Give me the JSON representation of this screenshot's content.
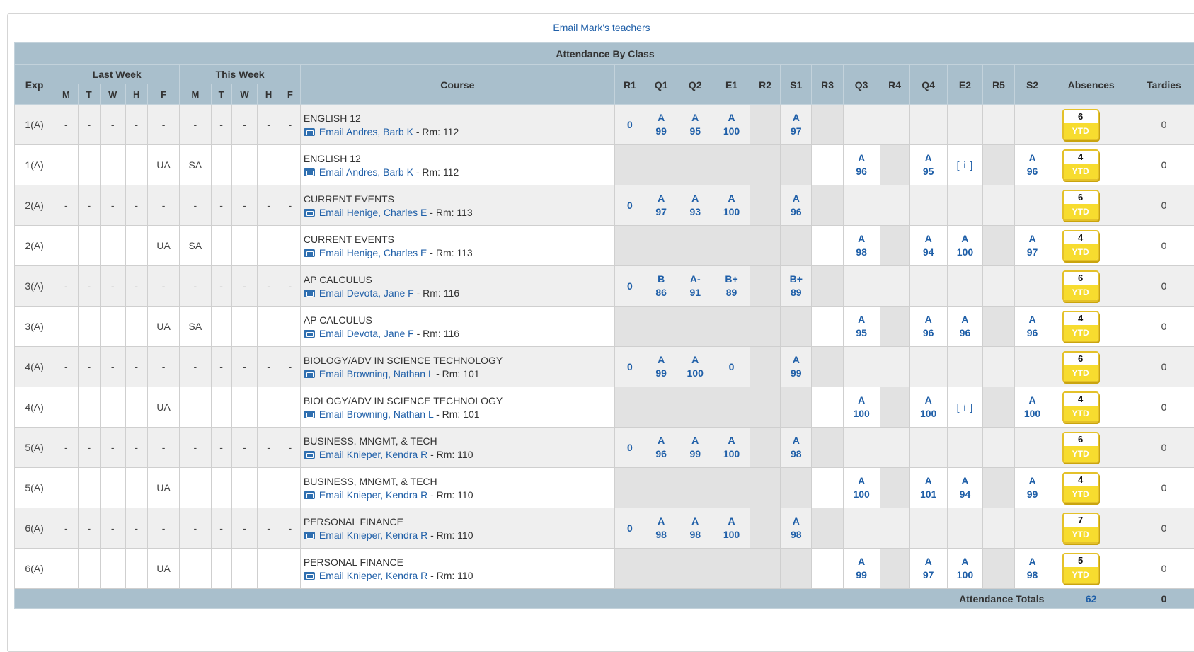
{
  "email_link": "Email Mark's teachers",
  "table_title": "Attendance By Class",
  "headers": {
    "exp": "Exp",
    "last_week": "Last Week",
    "this_week": "This Week",
    "days": [
      "M",
      "T",
      "W",
      "H",
      "F"
    ],
    "course": "Course",
    "terms": [
      "R1",
      "Q1",
      "Q2",
      "E1",
      "R2",
      "S1",
      "R3",
      "Q3",
      "R4",
      "Q4",
      "E2",
      "R5",
      "S2"
    ],
    "absences": "Absences",
    "tardies": "Tardies"
  },
  "ytd_label": "YTD",
  "rows": [
    {
      "exp": "1(A)",
      "days": [
        "-",
        "-",
        "-",
        "-",
        "-",
        "-",
        "-",
        "-",
        "-",
        "-"
      ],
      "course": "ENGLISH 12",
      "email": "Email Andres, Barb K",
      "room": " - Rm: 112",
      "terms": [
        {
          "v": "0"
        },
        {
          "l": "A",
          "n": "99"
        },
        {
          "l": "A",
          "n": "95"
        },
        {
          "l": "A",
          "n": "100"
        },
        {
          "h": 1
        },
        {
          "l": "A",
          "n": "97"
        },
        {
          "h": 1
        },
        {},
        {},
        {},
        {},
        {},
        {}
      ],
      "absences": "6",
      "tardies": "0"
    },
    {
      "exp": "1(A)",
      "days": [
        "",
        "",
        "",
        "",
        "UA",
        "SA",
        "",
        "",
        "",
        ""
      ],
      "course": "ENGLISH 12",
      "email": "Email Andres, Barb K",
      "room": " - Rm: 112",
      "terms": [
        {
          "h": 1
        },
        {
          "h": 1
        },
        {
          "h": 1
        },
        {
          "h": 1
        },
        {
          "h": 1
        },
        {
          "h": 1
        },
        {},
        {
          "l": "A",
          "n": "96"
        },
        {
          "h": 1
        },
        {
          "l": "A",
          "n": "95"
        },
        {
          "i": "[ i ]"
        },
        {
          "h": 1
        },
        {
          "l": "A",
          "n": "96"
        }
      ],
      "absences": "4",
      "tardies": "0"
    },
    {
      "exp": "2(A)",
      "days": [
        "-",
        "-",
        "-",
        "-",
        "-",
        "-",
        "-",
        "-",
        "-",
        "-"
      ],
      "course": "CURRENT EVENTS",
      "email": "Email Henige, Charles E",
      "room": " - Rm: 113",
      "terms": [
        {
          "v": "0"
        },
        {
          "l": "A",
          "n": "97"
        },
        {
          "l": "A",
          "n": "93"
        },
        {
          "l": "A",
          "n": "100"
        },
        {
          "h": 1
        },
        {
          "l": "A",
          "n": "96"
        },
        {
          "h": 1
        },
        {},
        {},
        {},
        {},
        {},
        {}
      ],
      "absences": "6",
      "tardies": "0"
    },
    {
      "exp": "2(A)",
      "days": [
        "",
        "",
        "",
        "",
        "UA",
        "SA",
        "",
        "",
        "",
        ""
      ],
      "course": "CURRENT EVENTS",
      "email": "Email Henige, Charles E",
      "room": " - Rm: 113",
      "terms": [
        {
          "h": 1
        },
        {
          "h": 1
        },
        {
          "h": 1
        },
        {
          "h": 1
        },
        {
          "h": 1
        },
        {
          "h": 1
        },
        {},
        {
          "l": "A",
          "n": "98"
        },
        {
          "h": 1
        },
        {
          "l": "A",
          "n": "94"
        },
        {
          "l": "A",
          "n": "100"
        },
        {
          "h": 1
        },
        {
          "l": "A",
          "n": "97"
        }
      ],
      "absences": "4",
      "tardies": "0"
    },
    {
      "exp": "3(A)",
      "days": [
        "-",
        "-",
        "-",
        "-",
        "-",
        "-",
        "-",
        "-",
        "-",
        "-"
      ],
      "course": "AP CALCULUS",
      "email": "Email Devota, Jane F",
      "room": " - Rm: 116",
      "terms": [
        {
          "v": "0"
        },
        {
          "l": "B",
          "n": "86"
        },
        {
          "l": "A-",
          "n": "91"
        },
        {
          "l": "B+",
          "n": "89"
        },
        {
          "h": 1
        },
        {
          "l": "B+",
          "n": "89"
        },
        {
          "h": 1
        },
        {},
        {},
        {},
        {},
        {},
        {}
      ],
      "absences": "6",
      "tardies": "0"
    },
    {
      "exp": "3(A)",
      "days": [
        "",
        "",
        "",
        "",
        "UA",
        "SA",
        "",
        "",
        "",
        ""
      ],
      "course": "AP CALCULUS",
      "email": "Email Devota, Jane F",
      "room": " - Rm: 116",
      "terms": [
        {
          "h": 1
        },
        {
          "h": 1
        },
        {
          "h": 1
        },
        {
          "h": 1
        },
        {
          "h": 1
        },
        {
          "h": 1
        },
        {},
        {
          "l": "A",
          "n": "95"
        },
        {
          "h": 1
        },
        {
          "l": "A",
          "n": "96"
        },
        {
          "l": "A",
          "n": "96"
        },
        {
          "h": 1
        },
        {
          "l": "A",
          "n": "96"
        }
      ],
      "absences": "4",
      "tardies": "0"
    },
    {
      "exp": "4(A)",
      "days": [
        "-",
        "-",
        "-",
        "-",
        "-",
        "-",
        "-",
        "-",
        "-",
        "-"
      ],
      "course": "BIOLOGY/ADV IN SCIENCE TECHNOLOGY",
      "email": "Email Browning, Nathan L",
      "room": " - Rm: 101",
      "terms": [
        {
          "v": "0"
        },
        {
          "l": "A",
          "n": "99"
        },
        {
          "l": "A",
          "n": "100"
        },
        {
          "v": "0"
        },
        {
          "h": 1
        },
        {
          "l": "A",
          "n": "99"
        },
        {
          "h": 1
        },
        {},
        {},
        {},
        {},
        {},
        {}
      ],
      "absences": "6",
      "tardies": "0"
    },
    {
      "exp": "4(A)",
      "days": [
        "",
        "",
        "",
        "",
        "UA",
        "",
        "",
        "",
        "",
        ""
      ],
      "course": "BIOLOGY/ADV IN SCIENCE TECHNOLOGY",
      "email": "Email Browning, Nathan L",
      "room": " - Rm: 101",
      "terms": [
        {
          "h": 1
        },
        {
          "h": 1
        },
        {
          "h": 1
        },
        {
          "h": 1
        },
        {
          "h": 1
        },
        {
          "h": 1
        },
        {},
        {
          "l": "A",
          "n": "100"
        },
        {
          "h": 1
        },
        {
          "l": "A",
          "n": "100"
        },
        {
          "i": "[ i ]"
        },
        {
          "h": 1
        },
        {
          "l": "A",
          "n": "100"
        }
      ],
      "absences": "4",
      "tardies": "0"
    },
    {
      "exp": "5(A)",
      "days": [
        "-",
        "-",
        "-",
        "-",
        "-",
        "-",
        "-",
        "-",
        "-",
        "-"
      ],
      "course": "BUSINESS, MNGMT, & TECH",
      "email": "Email Knieper, Kendra R",
      "room": " - Rm: 110",
      "terms": [
        {
          "v": "0"
        },
        {
          "l": "A",
          "n": "96"
        },
        {
          "l": "A",
          "n": "99"
        },
        {
          "l": "A",
          "n": "100"
        },
        {
          "h": 1
        },
        {
          "l": "A",
          "n": "98"
        },
        {
          "h": 1
        },
        {},
        {},
        {},
        {},
        {},
        {}
      ],
      "absences": "6",
      "tardies": "0"
    },
    {
      "exp": "5(A)",
      "days": [
        "",
        "",
        "",
        "",
        "UA",
        "",
        "",
        "",
        "",
        ""
      ],
      "course": "BUSINESS, MNGMT, & TECH",
      "email": "Email Knieper, Kendra R",
      "room": " - Rm: 110",
      "terms": [
        {
          "h": 1
        },
        {
          "h": 1
        },
        {
          "h": 1
        },
        {
          "h": 1
        },
        {
          "h": 1
        },
        {
          "h": 1
        },
        {},
        {
          "l": "A",
          "n": "100"
        },
        {
          "h": 1
        },
        {
          "l": "A",
          "n": "101"
        },
        {
          "l": "A",
          "n": "94"
        },
        {
          "h": 1
        },
        {
          "l": "A",
          "n": "99"
        }
      ],
      "absences": "4",
      "tardies": "0"
    },
    {
      "exp": "6(A)",
      "days": [
        "-",
        "-",
        "-",
        "-",
        "-",
        "-",
        "-",
        "-",
        "-",
        "-"
      ],
      "course": "PERSONAL FINANCE",
      "email": "Email Knieper, Kendra R",
      "room": " - Rm: 110",
      "terms": [
        {
          "v": "0"
        },
        {
          "l": "A",
          "n": "98"
        },
        {
          "l": "A",
          "n": "98"
        },
        {
          "l": "A",
          "n": "100"
        },
        {
          "h": 1
        },
        {
          "l": "A",
          "n": "98"
        },
        {
          "h": 1
        },
        {},
        {},
        {},
        {},
        {},
        {}
      ],
      "absences": "7",
      "tardies": "0"
    },
    {
      "exp": "6(A)",
      "days": [
        "",
        "",
        "",
        "",
        "UA",
        "",
        "",
        "",
        "",
        ""
      ],
      "course": "PERSONAL FINANCE",
      "email": "Email Knieper, Kendra R",
      "room": " - Rm: 110",
      "terms": [
        {
          "h": 1
        },
        {
          "h": 1
        },
        {
          "h": 1
        },
        {
          "h": 1
        },
        {
          "h": 1
        },
        {
          "h": 1
        },
        {},
        {
          "l": "A",
          "n": "99"
        },
        {
          "h": 1
        },
        {
          "l": "A",
          "n": "97"
        },
        {
          "l": "A",
          "n": "100"
        },
        {
          "h": 1
        },
        {
          "l": "A",
          "n": "98"
        }
      ],
      "absences": "5",
      "tardies": "0"
    }
  ],
  "totals": {
    "label": "Attendance Totals",
    "absences": "62",
    "tardies": "0"
  }
}
